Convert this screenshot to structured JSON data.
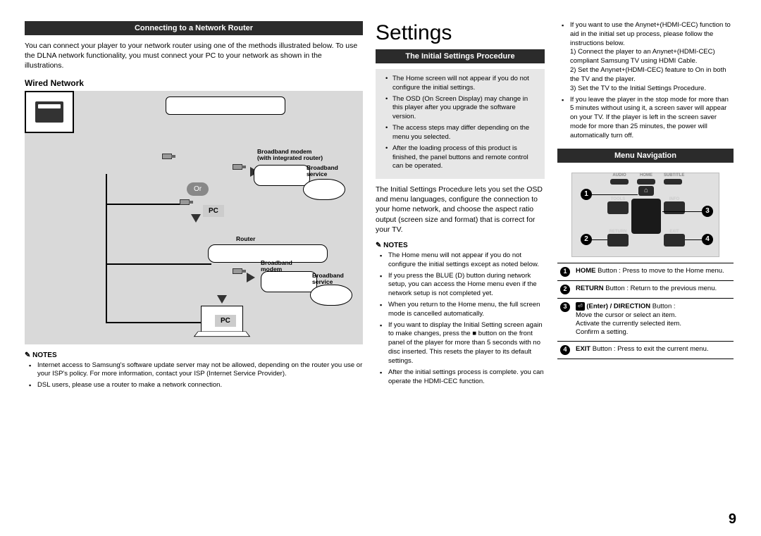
{
  "left": {
    "bar": "Connecting to a Network Router",
    "intro": "You can connect your player to your network router using one of the methods illustrated below. To use the DLNA network functionality, you must connect your PC to your network as shown in the illustrations.",
    "subhead": "Wired Network",
    "diagram": {
      "or": "Or",
      "pc1": "PC",
      "pc2": "PC",
      "label_modem_integrated": "Broadband modem\n(with integrated router)",
      "label_bbservice1": "Broadband\nservice",
      "label_router": "Router",
      "label_bbmodem": "Broadband\nmodem",
      "label_bbservice2": "Broadband\nservice"
    },
    "notes_hd": "NOTES",
    "notes": [
      "Internet access to Samsung's software update server may not be allowed, depending on the router you use or your ISP's policy. For more information, contact your ISP (Internet Service Provider).",
      "DSL users, please use a router to make a network connection."
    ]
  },
  "mid": {
    "title": "Settings",
    "bar": "The Initial Settings Procedure",
    "gray_items": [
      "The Home screen will not appear if you do not configure the initial settings.",
      "The OSD (On Screen Display) may change in this player after you upgrade the software version.",
      "The access steps may differ depending on the menu you selected.",
      "After the loading process of this product is finished, the panel buttons and remote control can be operated."
    ],
    "para": "The Initial Settings Procedure lets you set the OSD and menu languages, configure the connection to your home network, and choose the aspect ratio output (screen size and format) that is correct for your TV.",
    "notes_hd": "NOTES",
    "notes": [
      "The Home menu will not appear if you do not configure the initial settings except as noted below.",
      "If you press the BLUE (D) button during network setup, you can access the Home menu even if the network setup is not completed yet.",
      "When you return to the Home menu, the full screen mode is cancelled automatically.",
      "If you want to display the Initial Setting screen again to make changes, press the ■ button on the front panel of the player for more than 5 seconds with no disc inserted. This resets the player to its default settings.",
      "After the initial settings process is complete. you can operate the HDMI-CEC function."
    ]
  },
  "right": {
    "notes": [
      "If you want to use the Anynet+(HDMI-CEC) function to aid in the initial set up process, please follow the instructions below.\n1) Connect the player to an Anynet+(HDMI-CEC) compliant Samsung TV using HDMI Cable.\n2) Set the Anynet+(HDMI-CEC) feature to On in both the TV and the player.\n3) Set the TV to the Initial Settings Procedure.",
      "If you leave the player in the stop mode for more than 5 minutes without using it, a screen saver will appear on your TV. If the player is left in the screen saver mode for more than 25 minutes, the power will automatically turn off."
    ],
    "bar": "Menu Navigation",
    "remote_labels": {
      "audio": "AUDIO",
      "home": "HOME",
      "subtitle": "SUBTITLE",
      "tools": "TOOLS",
      "info": "INFO",
      "return": "RETURN",
      "exit": "EXIT"
    },
    "table": [
      {
        "n": "1",
        "text": "HOME Button : Press to move to the Home menu.",
        "bold": "HOME"
      },
      {
        "n": "2",
        "text": "RETURN Button : Return to the previous menu.",
        "bold": "RETURN"
      },
      {
        "n": "3",
        "text": "(Enter) / DIRECTION Button :\nMove the cursor or select an item.\nActivate the currently selected item.\nConfirm a setting.",
        "bold": "(Enter) / DIRECTION",
        "enter": true
      },
      {
        "n": "4",
        "text": "EXIT Button : Press to exit the current menu.",
        "bold": "EXIT"
      }
    ]
  },
  "page_number": "9"
}
